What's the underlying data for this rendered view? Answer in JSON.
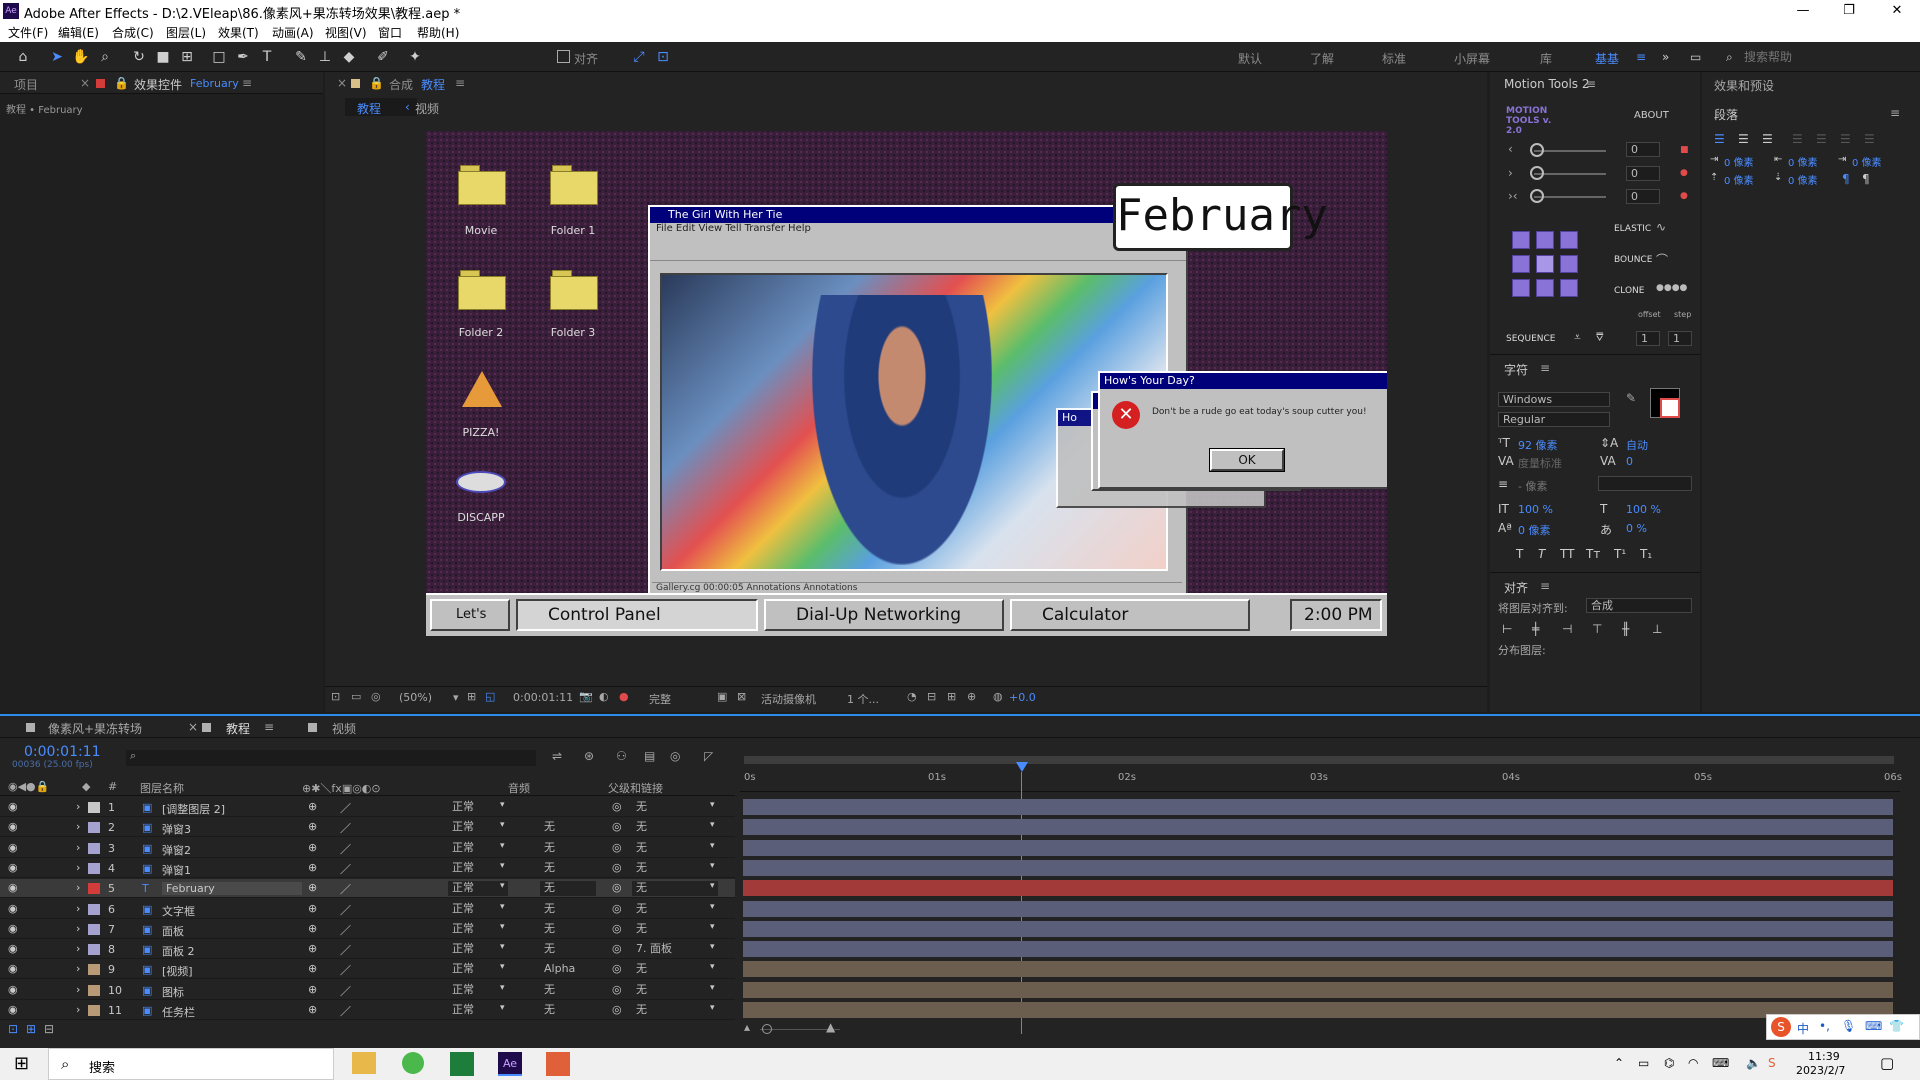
{
  "window": {
    "title": "Adobe After Effects - D:\\2.VEleap\\86.像素风+果冻转场效果\\教程.aep *",
    "min": "—",
    "max": "❐",
    "close": "✕"
  },
  "menu": [
    "文件(F)",
    "编辑(E)",
    "合成(C)",
    "图层(L)",
    "效果(T)",
    "动画(A)",
    "视图(V)",
    "窗口",
    "帮助(H)"
  ],
  "toolbar": {
    "snap_label": "对齐",
    "workspaces": [
      "默认",
      "了解",
      "标准",
      "小屏幕",
      "库",
      "基基"
    ],
    "search_placeholder": "搜索帮助"
  },
  "left_panel": {
    "tab_project": "项目",
    "tab_effects": "效果控件",
    "tab_effects_target": "February",
    "breadcrumb": "教程 • February"
  },
  "comp_panel": {
    "tab_prefix": "合成",
    "tab_name": "教程",
    "sub_tabs": [
      "教程",
      "视频"
    ],
    "footer": {
      "zoom": "(50%)",
      "time": "0:00:01:11",
      "quality": "完整",
      "camera": "活动摄像机",
      "views": "1 个...",
      "exposure": "+0.0"
    }
  },
  "viewer": {
    "desktop_icons": [
      "Movie",
      "Folder 1",
      "Folder 2",
      "Folder 3",
      "PIZZA!",
      "DISCAPP"
    ],
    "main_window": {
      "title": "The Girl With Her Tie",
      "menu": "File  Edit  View  Tell  Transfer  Help",
      "status": "Gallery.cg 00:00:05      Annotations      Annotations"
    },
    "badge": "February",
    "dialog": {
      "title": "How's Your Day?",
      "message": "Don't be a rude go eat today's soup cutter you!",
      "ok": "OK",
      "back_title": "Ho"
    },
    "taskbar": [
      {
        "label": "Let's Go"
      },
      {
        "label": "Control Panel"
      },
      {
        "label": "Dial-Up Networking"
      },
      {
        "label": "Calculator"
      }
    ],
    "clock": "2:00 PM"
  },
  "motion_tools": {
    "title": "Motion Tools 2",
    "logo": "MOTION TOOLS v. 2.0",
    "about": "ABOUT",
    "values": [
      "0",
      "0",
      "0"
    ],
    "elastic": "ELASTIC",
    "bounce": "BOUNCE",
    "clone": "CLONE",
    "offset": "offset",
    "step": "step",
    "sequence": "SEQUENCE",
    "seq_vals": [
      "1",
      "1"
    ]
  },
  "character": {
    "title": "字符",
    "font": "Windows",
    "style": "Regular",
    "size": "92 像素",
    "leading": "自动",
    "kerning": "度量标准",
    "tracking": "0",
    "stroke": "- 像素",
    "vscale": "100 %",
    "hscale": "100 %",
    "baseline": "0 像素",
    "tsume": "0 %",
    "styles": [
      "T",
      "T",
      "TT",
      "Tт",
      "T¹",
      "T₁"
    ]
  },
  "align": {
    "title": "对齐",
    "align_to_label": "将图层对齐到:",
    "align_to": "合成",
    "distribute": "分布图层:"
  },
  "far_right": {
    "tab": "效果和预设",
    "paragraph": "段落",
    "indents": [
      "0 像素",
      "0 像素",
      "0 像素",
      "0 像素",
      "0 像素"
    ]
  },
  "timeline": {
    "tabs": [
      "像素风+果冻转场",
      "教程",
      "视频"
    ],
    "timecode": "0:00:01:11",
    "fps": "00036 (25.00 fps)",
    "search_placeholder": "",
    "headers": {
      "num": "#",
      "name": "图层名称",
      "mode": "音频",
      "parent": "父级和链接"
    },
    "ruler": [
      "0s",
      "01s",
      "02s",
      "03s",
      "04s",
      "05s",
      "06s"
    ],
    "layers": [
      {
        "n": "1",
        "name": "[调整图层 2]",
        "mode": "正常",
        "trk": "",
        "parent": "无",
        "color": "#c8c8c8",
        "bar": "#5b5e79"
      },
      {
        "n": "2",
        "name": "弹窗3",
        "mode": "正常",
        "trk": "无",
        "parent": "无",
        "color": "#a5a2cf",
        "bar": "#5b5e79"
      },
      {
        "n": "3",
        "name": "弹窗2",
        "mode": "正常",
        "trk": "无",
        "parent": "无",
        "color": "#a5a2cf",
        "bar": "#5b5e79"
      },
      {
        "n": "4",
        "name": "弹窗1",
        "mode": "正常",
        "trk": "无",
        "parent": "无",
        "color": "#a5a2cf",
        "bar": "#5b5e79"
      },
      {
        "n": "5",
        "name": "February",
        "mode": "正常",
        "trk": "无",
        "parent": "无",
        "color": "#d43b3b",
        "bar": "#a33a3a"
      },
      {
        "n": "6",
        "name": "文字框",
        "mode": "正常",
        "trk": "无",
        "parent": "无",
        "color": "#a5a2cf",
        "bar": "#5b5e79"
      },
      {
        "n": "7",
        "name": "面板",
        "mode": "正常",
        "trk": "无",
        "parent": "无",
        "color": "#a5a2cf",
        "bar": "#5b5e79"
      },
      {
        "n": "8",
        "name": "面板 2",
        "mode": "正常",
        "trk": "无",
        "parent": "7. 面板",
        "color": "#a5a2cf",
        "bar": "#5b5e79"
      },
      {
        "n": "9",
        "name": "[视频]",
        "mode": "正常",
        "trk": "Alpha",
        "parent": "无",
        "color": "#b99a77",
        "bar": "#6b5e4e"
      },
      {
        "n": "10",
        "name": "图标",
        "mode": "正常",
        "trk": "无",
        "parent": "无",
        "color": "#b99a77",
        "bar": "#6b5e4e"
      },
      {
        "n": "11",
        "name": "任务栏",
        "mode": "正常",
        "trk": "无",
        "parent": "无",
        "color": "#b99a77",
        "bar": "#6b5e4e"
      }
    ]
  },
  "windows_taskbar": {
    "search": "搜索",
    "time": "11:39",
    "date": "2023/2/7",
    "ime": "中"
  }
}
